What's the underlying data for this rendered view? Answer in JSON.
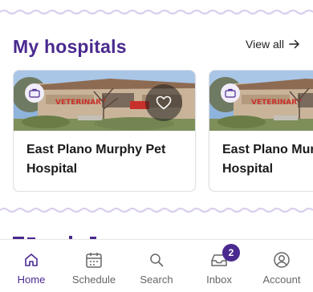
{
  "my_hospitals": {
    "title": "My hospitals",
    "view_all_label": "View all",
    "cards": [
      {
        "name": "East Plano Murphy Pet Hospital"
      },
      {
        "name": "East Plano Murphy Pet Hospital"
      }
    ]
  },
  "bottom_nav": {
    "items": [
      {
        "label": "Home",
        "icon": "home-icon",
        "active": true
      },
      {
        "label": "Schedule",
        "icon": "calendar-icon",
        "active": false
      },
      {
        "label": "Search",
        "icon": "search-icon",
        "active": false
      },
      {
        "label": "Inbox",
        "icon": "inbox-icon",
        "active": false,
        "badge": "2"
      },
      {
        "label": "Account",
        "icon": "account-icon",
        "active": false
      }
    ]
  },
  "colors": {
    "brand": "#4a2a8f",
    "wave": "#d9cfee",
    "nav_inactive": "#666666"
  }
}
